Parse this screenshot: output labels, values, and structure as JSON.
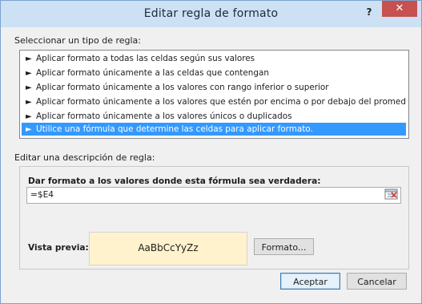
{
  "dialog": {
    "title": "Editar regla de formato",
    "help_glyph": "?",
    "close_glyph": "✕"
  },
  "rule_type": {
    "label": "Seleccionar un tipo de regla:",
    "items": [
      {
        "text": "Aplicar formato a todas las celdas según sus valores",
        "selected": false
      },
      {
        "text": "Aplicar formato únicamente a las celdas que contengan",
        "selected": false
      },
      {
        "text": "Aplicar formato únicamente a los valores con rango inferior o superior",
        "selected": false
      },
      {
        "text": "Aplicar formato únicamente a los valores que estén por encima o por debajo del promedio",
        "selected": false
      },
      {
        "text": "Aplicar formato únicamente a los valores únicos o duplicados",
        "selected": false
      },
      {
        "text": "Utilice una fórmula que determine las celdas para aplicar formato.",
        "selected": true
      }
    ],
    "arrow_glyph": "►"
  },
  "description": {
    "label": "Editar una descripción de regla:",
    "formula_heading": "Dar formato a los valores donde esta fórmula sea verdadera:",
    "formula_value": "=$E4",
    "preview_label": "Vista previa:",
    "preview_sample": "AaBbCcYyZz",
    "preview_fill": "#fff2cc",
    "format_button": "Formato..."
  },
  "footer": {
    "accept_button": "Aceptar",
    "cancel_button": "Cancelar"
  },
  "colors": {
    "selection": "#3399ff",
    "close": "#c75050",
    "titlebar": "#cde1f5"
  }
}
